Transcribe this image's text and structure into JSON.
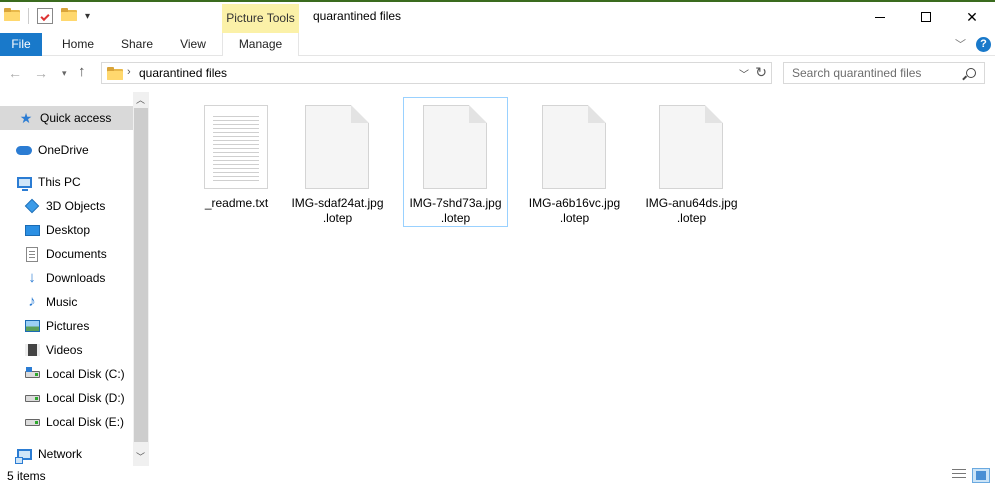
{
  "window": {
    "title": "quarantined files",
    "context_tab_group": "Picture Tools",
    "controls": {
      "minimize": "—",
      "maximize": "☐",
      "close": "✕"
    }
  },
  "ribbon": {
    "tabs": {
      "file": "File",
      "home": "Home",
      "share": "Share",
      "view": "View",
      "manage": "Manage"
    },
    "help": "?"
  },
  "address": {
    "path": "quarantined files",
    "separator": "›"
  },
  "search": {
    "placeholder": "Search quarantined files"
  },
  "nav": {
    "quick_access": "Quick access",
    "onedrive": "OneDrive",
    "this_pc": "This PC",
    "objects3d": "3D Objects",
    "desktop": "Desktop",
    "documents": "Documents",
    "downloads": "Downloads",
    "music": "Music",
    "pictures": "Pictures",
    "videos": "Videos",
    "disk_c": "Local Disk (C:)",
    "disk_d": "Local Disk (D:)",
    "disk_e": "Local Disk (E:)",
    "network": "Network"
  },
  "files": [
    {
      "name": "_readme.txt",
      "type": "text"
    },
    {
      "name": "IMG-sdaf24at.jpg .lotep",
      "type": "blank"
    },
    {
      "name": "IMG-7shd73a.jpg .lotep",
      "type": "blank"
    },
    {
      "name": "IMG-a6b16vc.jpg .lotep",
      "type": "blank"
    },
    {
      "name": "IMG-anu64ds.jpg .lotep",
      "type": "blank"
    }
  ],
  "status": {
    "item_count": "5 items"
  },
  "colors": {
    "file_tab": "#1979ca",
    "picture_tools": "#fbf1a8",
    "selected_nav": "#d9d9d9",
    "focus_border": "#99d1ff"
  }
}
